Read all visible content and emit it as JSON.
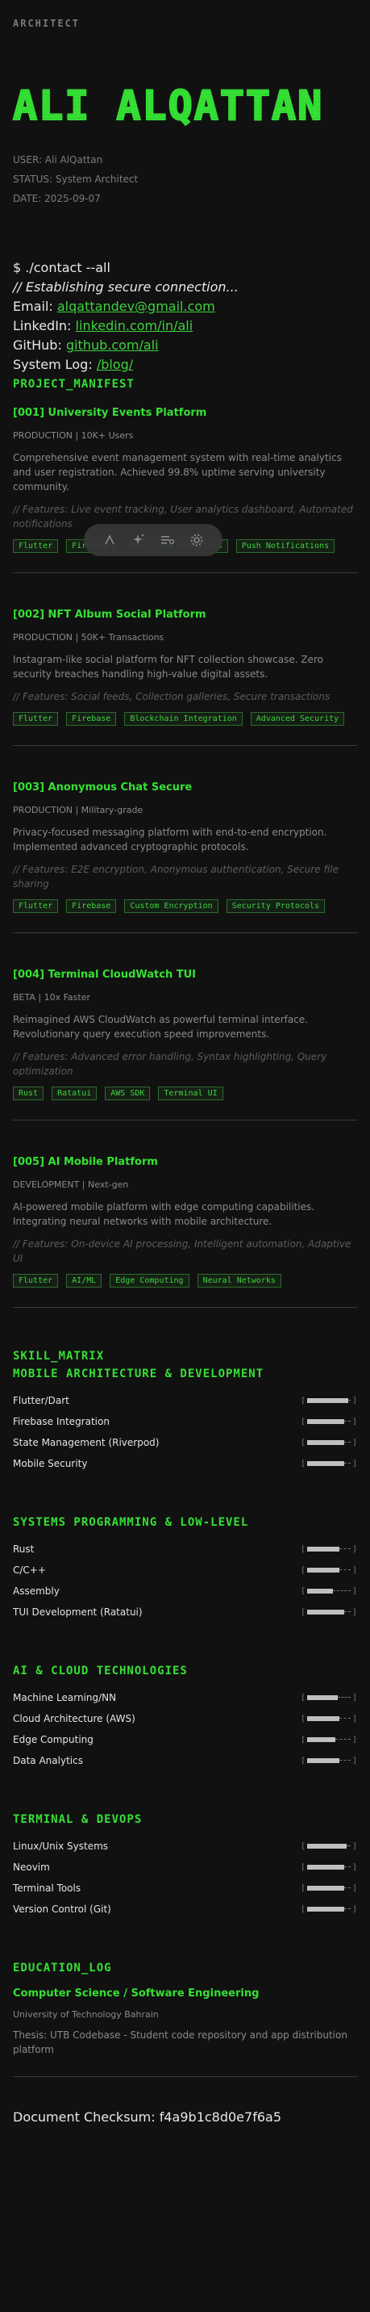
{
  "header": {
    "label": "ARCHITECT",
    "logo_text": "ALI ALQATTAN"
  },
  "meta": {
    "user": "USER: Ali AlQattan",
    "status": "STATUS: System Architect",
    "date": "DATE: 2025-09-07"
  },
  "contact": {
    "command": "$ ./contact --all",
    "comment": "// Establishing secure connection...",
    "email_label": "Email:",
    "email": "alqattandev@gmail.com",
    "linkedin_label": "LinkedIn:",
    "linkedin": "linkedin.com/in/ali",
    "github_label": "GitHub:",
    "github": "github.com/ali",
    "syslog_label": "System Log:",
    "syslog": "/blog/"
  },
  "projects_heading": "PROJECT_MANIFEST",
  "projects": [
    {
      "title": "[001] University Events Platform",
      "sub": "PRODUCTION | 10K+ Users",
      "desc": "Comprehensive event management system with real-time analytics and user registration. Achieved 99.8% uptime serving university community.",
      "features": "// Features: Live event tracking, User analytics dashboard, Automated notifications",
      "tags": [
        "Flutter",
        "Firebase",
        "Real-time Analytics",
        "Push Notifications"
      ]
    },
    {
      "title": "[002] NFT Album Social Platform",
      "sub": "PRODUCTION | 50K+ Transactions",
      "desc": "Instagram-like social platform for NFT collection showcase. Zero security breaches handling high-value digital assets.",
      "features": "// Features: Social feeds, Collection galleries, Secure transactions",
      "tags": [
        "Flutter",
        "Firebase",
        "Blockchain Integration",
        "Advanced Security"
      ]
    },
    {
      "title": "[003] Anonymous Chat Secure",
      "sub": "PRODUCTION | Military-grade",
      "desc": "Privacy-focused messaging platform with end-to-end encryption. Implemented advanced cryptographic protocols.",
      "features": "// Features: E2E encryption, Anonymous authentication, Secure file sharing",
      "tags": [
        "Flutter",
        "Firebase",
        "Custom Encryption",
        "Security Protocols"
      ]
    },
    {
      "title": "[004] Terminal CloudWatch TUI",
      "sub": "BETA | 10x Faster",
      "desc": "Reimagined AWS CloudWatch as powerful terminal interface. Revolutionary query execution speed improvements.",
      "features": "// Features: Advanced error handling, Syntax highlighting, Query optimization",
      "tags": [
        "Rust",
        "Ratatui",
        "AWS SDK",
        "Terminal UI"
      ]
    },
    {
      "title": "[005] AI Mobile Platform",
      "sub": "DEVELOPMENT | Next-gen",
      "desc": "AI-powered mobile platform with edge computing capabilities. Integrating neural networks with mobile architecture.",
      "features": "// Features: On-device AI processing, Intelligent automation, Adaptive UI",
      "tags": [
        "Flutter",
        "AI/ML",
        "Edge Computing",
        "Neural Networks"
      ]
    }
  ],
  "skills_heading": "SKILL_MATRIX",
  "skill_groups": [
    {
      "title": "MOBILE ARCHITECTURE & DEVELOPMENT",
      "items": [
        {
          "name": "Flutter/Dart",
          "level": 0.95
        },
        {
          "name": "Firebase Integration",
          "level": 0.85
        },
        {
          "name": "State Management (Riverpod)",
          "level": 0.85
        },
        {
          "name": "Mobile Security",
          "level": 0.85
        }
      ]
    },
    {
      "title": "SYSTEMS PROGRAMMING & LOW-LEVEL",
      "items": [
        {
          "name": "Rust",
          "level": 0.75
        },
        {
          "name": "C/C++",
          "level": 0.75
        },
        {
          "name": "Assembly",
          "level": 0.6
        },
        {
          "name": "TUI Development (Ratatui)",
          "level": 0.85
        }
      ]
    },
    {
      "title": "AI & CLOUD TECHNOLOGIES",
      "items": [
        {
          "name": "Machine Learning/NN",
          "level": 0.7
        },
        {
          "name": "Cloud Architecture (AWS)",
          "level": 0.75
        },
        {
          "name": "Edge Computing",
          "level": 0.65
        },
        {
          "name": "Data Analytics",
          "level": 0.75
        }
      ]
    },
    {
      "title": "TERMINAL & DEVOPS",
      "items": [
        {
          "name": "Linux/Unix Systems",
          "level": 0.9
        },
        {
          "name": "Neovim",
          "level": 0.85
        },
        {
          "name": "Terminal Tools",
          "level": 0.85
        },
        {
          "name": "Version Control (Git)",
          "level": 0.85
        }
      ]
    }
  ],
  "education": {
    "heading": "EDUCATION_LOG",
    "degree": "Computer Science / Software Engineering",
    "school": "University of Technology Bahrain",
    "thesis": "Thesis: UTB Codebase - Student code repository and app distribution platform"
  },
  "checksum": "Document Checksum: f4a9b1c8d0e7f6a5",
  "toolbar": {
    "icons": [
      "text-icon",
      "sparkle-icon",
      "reader-list-icon",
      "settings-gear-icon"
    ]
  }
}
